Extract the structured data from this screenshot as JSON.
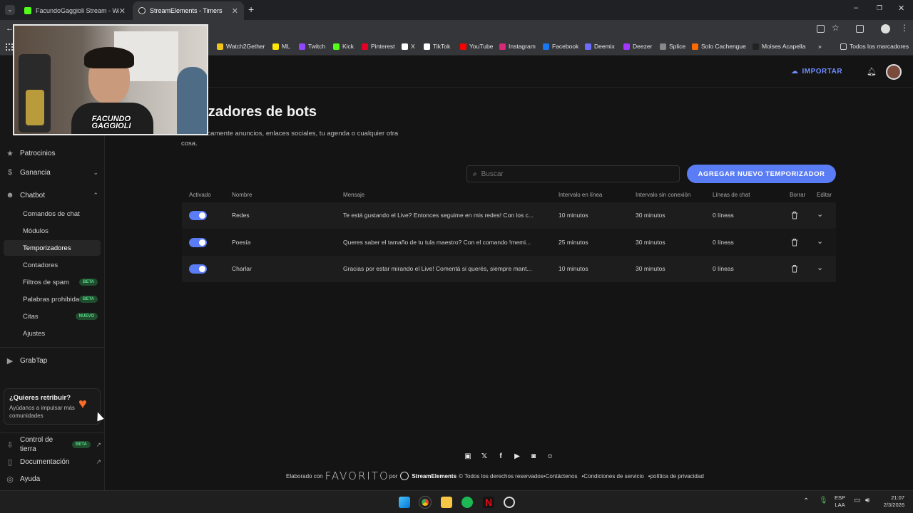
{
  "browser": {
    "tabs": [
      {
        "title": "FacundoGaggioli Stream - Watc",
        "active": false
      },
      {
        "title": "StreamElements - Timers",
        "active": true
      }
    ],
    "bookmarks": [
      {
        "label": "Watch2Gether",
        "color": "#f0c419"
      },
      {
        "label": "ML",
        "color": "#ffe600"
      },
      {
        "label": "Twitch",
        "color": "#9146ff"
      },
      {
        "label": "Kick",
        "color": "#53fc18"
      },
      {
        "label": "Pinterest",
        "color": "#e60023"
      },
      {
        "label": "X",
        "color": "#ffffff"
      },
      {
        "label": "TikTok",
        "color": "#ffffff"
      },
      {
        "label": "YouTube",
        "color": "#ff0000"
      },
      {
        "label": "Instagram",
        "color": "#d62976"
      },
      {
        "label": "Facebook",
        "color": "#1877f2"
      },
      {
        "label": "Deemix",
        "color": "#6c6cff"
      },
      {
        "label": "Deezer",
        "color": "#a238ff"
      },
      {
        "label": "Splice",
        "color": "#888888"
      },
      {
        "label": "Solo Cachengue",
        "color": "#ff6a00"
      },
      {
        "label": "Moises Acapella",
        "color": "#222222"
      }
    ],
    "all_bookmarks": "Todos los marcadores",
    "more_chevron": "»"
  },
  "sidebar": {
    "items_top": [
      {
        "label": "Patrocinios",
        "icon": "star-icon"
      },
      {
        "label": "Ganancia",
        "icon": "coin-icon"
      },
      {
        "label": "Chatbot",
        "icon": "chatbot-icon"
      }
    ],
    "chatbot_items": [
      {
        "label": "Comandos de chat",
        "badge": ""
      },
      {
        "label": "Módulos",
        "badge": ""
      },
      {
        "label": "Temporizadores",
        "badge": ""
      },
      {
        "label": "Contadores",
        "badge": ""
      },
      {
        "label": "Filtros de spam",
        "badge": "BETA"
      },
      {
        "label": "Palabras prohibidas",
        "badge": "BETA"
      },
      {
        "label": "Citas",
        "badge": "NUEVO"
      },
      {
        "label": "Ajustes",
        "badge": ""
      }
    ],
    "grabtap": "GrabTap",
    "promo": {
      "title": "¿Quieres retribuir?",
      "text": "Ayúdanos a impulsar más comunidades"
    },
    "bottom": [
      {
        "label": "Control de tierra",
        "badge": "BETA"
      },
      {
        "label": "Documentación",
        "badge": ""
      },
      {
        "label": "Ayuda",
        "badge": ""
      }
    ]
  },
  "topbar": {
    "import_label": "IMPORTAR"
  },
  "page": {
    "title": "Temporizadores de bots",
    "title_visible": "porizadores de bots",
    "description": "Publica automáticamente anuncios, enlaces sociales, tu agenda o cualquier otra cosa.",
    "description_line1": "automáticamente anuncios, enlaces sociales, tu agenda o cualquier otra",
    "description_line2": "cosa.",
    "search_placeholder": "Buscar",
    "add_button": "AGREGAR NUEVO TEMPORIZADOR"
  },
  "table": {
    "headers": [
      "Activado",
      "Nombre",
      "Mensaje",
      "Intervalo en línea",
      "Intervalo sin conexión",
      "Líneas de chat",
      "Borrar",
      "Editar"
    ],
    "rows": [
      {
        "enabled": true,
        "name": "Redes",
        "message": "Te está gustando el Live? Entonces seguime en mis redes! Con los c...",
        "online": "10 minutos",
        "offline": "30 minutos",
        "lines": "0 líneas"
      },
      {
        "enabled": true,
        "name": "Poesía",
        "message": "Queres saber el tamaño de tu tula maestro? Con el comando !memi...",
        "online": "25 minutos",
        "offline": "30 minutos",
        "lines": "0 líneas"
      },
      {
        "enabled": true,
        "name": "Charlar",
        "message": "Gracias por estar mirando el Live! Comentá si querés, siempre mant...",
        "online": "10 minutos",
        "offline": "30 minutos",
        "lines": "0 líneas"
      }
    ]
  },
  "webcam": {
    "overlay_line1": "FACUNDO",
    "overlay_line2": "GAGGIOLI"
  },
  "footer": {
    "made_with": "Elaborado con",
    "favorite": "FAVORITO",
    "by": "por",
    "brand": "StreamElements",
    "rights": "© Todos los derechos reservados",
    "contact": "Contáctenos",
    "terms": "Condiciones de servicio",
    "privacy": "política de privacidad"
  },
  "taskbar": {
    "lang1": "ESP",
    "lang2": "LAA",
    "time": "21:07",
    "date": "2/3/2026"
  },
  "colors": {
    "accent": "#5a7cf5",
    "bg": "#141414",
    "row": "#1d1d1d"
  }
}
